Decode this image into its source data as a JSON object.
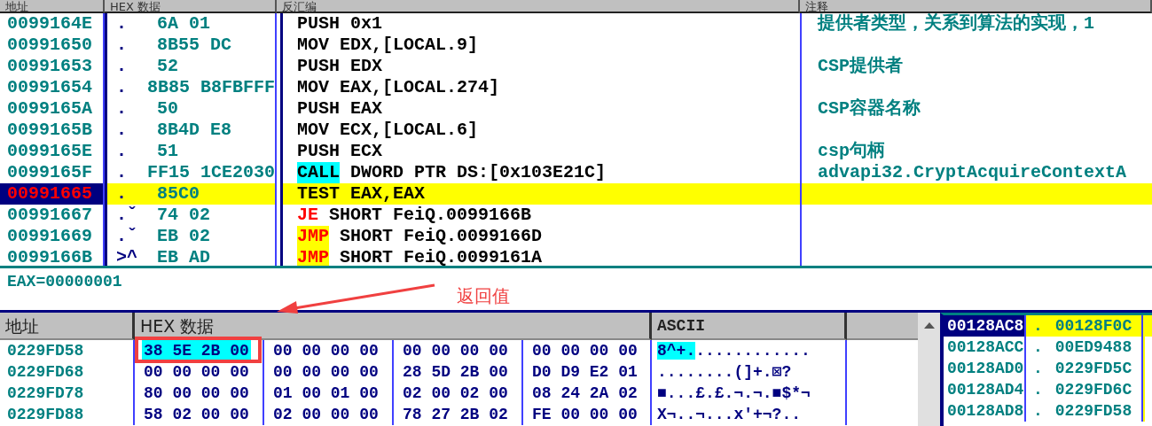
{
  "disassembly": {
    "columns": [
      "地址",
      "HEX 数据",
      "反汇编",
      "注释"
    ],
    "rows": [
      {
        "address": "0099164E",
        "marker": ".",
        "hex": "6A 01",
        "mnemonic": "PUSH",
        "operands": "0x1",
        "kind": "plain",
        "comment": "提供者类型，关系到算法的实现，1",
        "selected": false
      },
      {
        "address": "00991650",
        "marker": ".",
        "hex": "8B55 DC",
        "mnemonic": "MOV",
        "operands": "EDX,[LOCAL.9]",
        "kind": "plain",
        "selected": false
      },
      {
        "address": "00991653",
        "marker": ".",
        "hex": "52",
        "mnemonic": "PUSH",
        "operands": "EDX",
        "kind": "plain",
        "comment": "CSP提供者",
        "selected": false
      },
      {
        "address": "00991654",
        "marker": ".",
        "hex": "8B85 B8FBFFF",
        "mnemonic": "MOV",
        "operands": "EAX,[LOCAL.274]",
        "kind": "plain",
        "selected": false
      },
      {
        "address": "0099165A",
        "marker": ".",
        "hex": "50",
        "mnemonic": "PUSH",
        "operands": "EAX",
        "kind": "plain",
        "comment": "CSP容器名称",
        "selected": false
      },
      {
        "address": "0099165B",
        "marker": ".",
        "hex": "8B4D E8",
        "mnemonic": "MOV",
        "operands": "ECX,[LOCAL.6]",
        "kind": "plain",
        "selected": false
      },
      {
        "address": "0099165E",
        "marker": ".",
        "hex": "51",
        "mnemonic": "PUSH",
        "operands": "ECX",
        "kind": "plain",
        "comment": "csp句柄",
        "selected": false
      },
      {
        "address": "0099165F",
        "marker": ".",
        "hex": "FF15 1CE2030",
        "mnemonic": "CALL",
        "operands": "DWORD PTR DS:[0x103E21C]",
        "kind": "call",
        "comment": "advapi32.CryptAcquireContextA",
        "selected": false
      },
      {
        "address": "00991665",
        "marker": ".",
        "hex": "85C0",
        "mnemonic": "TEST",
        "operands": "EAX,EAX",
        "kind": "plain",
        "selected": true
      },
      {
        "address": "00991667",
        "marker": ".ˇ",
        "hex": "74 02",
        "mnemonic": "JE",
        "operands": "SHORT FeiQ.0099166B",
        "kind": "jcc",
        "selected": false
      },
      {
        "address": "00991669",
        "marker": ".ˇ",
        "hex": "EB 02",
        "mnemonic": "JMP",
        "operands": "SHORT FeiQ.0099166D",
        "kind": "jmp",
        "selected": false
      },
      {
        "address": "0099166B",
        "marker": ">^",
        "hex": "EB AD",
        "mnemonic": "JMP",
        "operands": "SHORT FeiQ.0099161A",
        "kind": "jmp",
        "selected": false
      }
    ]
  },
  "info": {
    "text": "EAX=00000001"
  },
  "annotation": {
    "label": "返回值"
  },
  "dump": {
    "columns": [
      "地址",
      "HEX 数据",
      "ASCII"
    ],
    "rows": [
      {
        "address": "0229FD58",
        "groups": [
          {
            "bytes": "38 5E 2B 00",
            "selected": true
          },
          {
            "bytes": "00 00 00 00",
            "selected": false
          },
          {
            "bytes": "00 00 00 00",
            "selected": false
          },
          {
            "bytes": "00 00 00 00",
            "selected": false
          }
        ],
        "ascii": [
          {
            "text": "8^+.",
            "selected": true
          },
          {
            "text": "............",
            "selected": false
          }
        ]
      },
      {
        "address": "0229FD68",
        "groups": [
          {
            "bytes": "00 00 00 00",
            "selected": false
          },
          {
            "bytes": "00 00 00 00",
            "selected": false
          },
          {
            "bytes": "28 5D 2B 00",
            "selected": false
          },
          {
            "bytes": "D0 D9 E2 01",
            "selected": false
          }
        ],
        "ascii": [
          {
            "text": "........(]+.⊠?",
            "selected": false
          }
        ]
      },
      {
        "address": "0229FD78",
        "groups": [
          {
            "bytes": "80 00 00 00",
            "selected": false
          },
          {
            "bytes": "01 00 01 00",
            "selected": false
          },
          {
            "bytes": "02 00 02 00",
            "selected": false
          },
          {
            "bytes": "08 24 2A 02",
            "selected": false
          }
        ],
        "ascii": [
          {
            "text": "■...£.£.¬.¬.■$*¬",
            "selected": false
          }
        ]
      },
      {
        "address": "0229FD88",
        "groups": [
          {
            "bytes": "58 02 00 00",
            "selected": false
          },
          {
            "bytes": "02 00 00 00",
            "selected": false
          },
          {
            "bytes": "78 27 2B 02",
            "selected": false
          },
          {
            "bytes": "FE 00 00 00",
            "selected": false
          }
        ],
        "ascii": [
          {
            "text": "X¬..¬...x'+¬?..",
            "selected": false
          }
        ]
      }
    ]
  },
  "stack": {
    "rows": [
      {
        "address": "00128AC8",
        "value": "00128F0C",
        "selected": true
      },
      {
        "address": "00128ACC",
        "value": "00ED9488",
        "selected": false
      },
      {
        "address": "00128AD0",
        "value": "0229FD5C",
        "selected": false
      },
      {
        "address": "00128AD4",
        "value": "0229FD6C",
        "selected": false
      },
      {
        "address": "00128AD8",
        "value": "0229FD58",
        "selected": false
      }
    ]
  }
}
